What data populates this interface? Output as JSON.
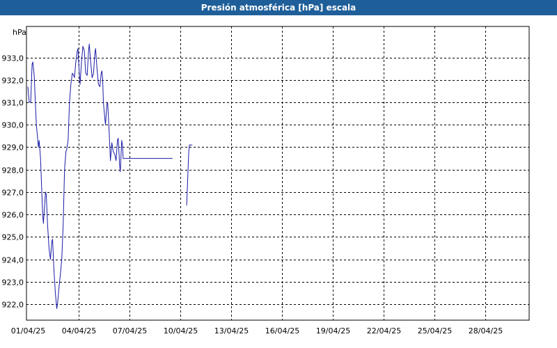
{
  "window": {
    "title": "Presión atmosférica [hPa] escala"
  },
  "colors": {
    "title_bar": "#1f5f99",
    "series": "#1a1aa6",
    "grid": "#000000"
  },
  "chart_data": {
    "type": "line",
    "title": "Presión atmosférica [hPa] escala",
    "ylabel": "hPa",
    "xlabel": "",
    "x_unit": "days",
    "xlim": [
      "01/04/25",
      "01/05/25"
    ],
    "ylim": [
      921.0,
      934.2
    ],
    "grid": true,
    "legend": "none",
    "yticks": [
      922.0,
      923.0,
      924.0,
      925.0,
      926.0,
      927.0,
      928.0,
      929.0,
      930.0,
      931.0,
      932.0,
      933.0
    ],
    "ytick_labels": [
      "922,0",
      "923,0",
      "924,0",
      "925,0",
      "926,0",
      "927,0",
      "928,0",
      "929,0",
      "930,0",
      "931,0",
      "932,0",
      "933,0"
    ],
    "xticks": [
      "01/04/25",
      "04/04/25",
      "07/04/25",
      "10/04/25",
      "13/04/25",
      "16/04/25",
      "19/04/25",
      "22/04/25",
      "25/04/25",
      "28/04/25"
    ],
    "series": [
      {
        "segments": [
          [
            [
              "01/04/25 00:00",
              931.7
            ],
            [
              "01/04/25 02:00",
              931.0
            ],
            [
              "01/04/25 04:00",
              931.0
            ],
            [
              "01/04/25 06:00",
              932.7
            ],
            [
              "01/04/25 07:00",
              932.8
            ],
            [
              "01/04/25 09:00",
              932.2
            ],
            [
              "01/04/25 12:00",
              930.0
            ],
            [
              "01/04/25 15:00",
              929.0
            ],
            [
              "01/04/25 16:00",
              929.3
            ],
            [
              "01/04/25 18:00",
              928.5
            ],
            [
              "01/04/25 21:00",
              926.0
            ],
            [
              "01/04/25 22:00",
              925.6
            ],
            [
              "02/04/25 00:00",
              926.5
            ],
            [
              "02/04/25 01:00",
              927.0
            ],
            [
              "02/04/25 02:00",
              926.9
            ],
            [
              "02/04/25 04:00",
              925.5
            ],
            [
              "02/04/25 06:00",
              924.5
            ],
            [
              "02/04/25 08:00",
              924.0
            ],
            [
              "02/04/25 10:00",
              924.8
            ],
            [
              "02/04/25 11:00",
              924.9
            ],
            [
              "02/04/25 13:00",
              923.5
            ],
            [
              "02/04/25 15:00",
              922.5
            ],
            [
              "02/04/25 17:00",
              921.8
            ],
            [
              "02/04/25 18:00",
              922.0
            ],
            [
              "02/04/25 20:00",
              922.7
            ],
            [
              "02/04/25 22:00",
              923.3
            ],
            [
              "03/04/25 00:00",
              924.0
            ],
            [
              "03/04/25 02:00",
              925.5
            ],
            [
              "03/04/25 04:00",
              928.0
            ],
            [
              "03/04/25 06:00",
              928.8
            ],
            [
              "03/04/25 07:00",
              928.9
            ],
            [
              "03/04/25 09:00",
              929.3
            ],
            [
              "03/04/25 11:00",
              931.0
            ],
            [
              "03/04/25 13:00",
              931.8
            ],
            [
              "03/04/25 15:00",
              932.3
            ],
            [
              "03/04/25 17:00",
              932.2
            ],
            [
              "03/04/25 18:00",
              932.1
            ],
            [
              "03/04/25 20:00",
              932.8
            ],
            [
              "03/04/25 22:00",
              933.3
            ],
            [
              "03/04/25 23:00",
              933.4
            ],
            [
              "04/04/25 01:00",
              932.2
            ],
            [
              "04/04/25 02:00",
              931.8
            ],
            [
              "04/04/25 04:00",
              932.8
            ],
            [
              "04/04/25 06:00",
              933.5
            ],
            [
              "04/04/25 08:00",
              933.3
            ],
            [
              "04/04/25 10:00",
              932.3
            ],
            [
              "04/04/25 12:00",
              932.2
            ],
            [
              "04/04/25 14:00",
              933.3
            ],
            [
              "04/04/25 15:00",
              933.6
            ],
            [
              "04/04/25 17:00",
              932.8
            ],
            [
              "04/04/25 19:00",
              932.1
            ],
            [
              "04/04/25 21:00",
              932.3
            ],
            [
              "04/04/25 23:00",
              933.2
            ],
            [
              "05/04/25 00:00",
              933.4
            ],
            [
              "05/04/25 02:00",
              932.5
            ],
            [
              "05/04/25 04:00",
              931.8
            ],
            [
              "05/04/25 06:00",
              931.7
            ],
            [
              "05/04/25 08:00",
              932.3
            ],
            [
              "05/04/25 09:00",
              932.4
            ],
            [
              "05/04/25 10:00",
              932.0
            ],
            [
              "05/04/25 11:00",
              931.0
            ],
            [
              "05/04/25 13:00",
              930.3
            ],
            [
              "05/04/25 14:00",
              930.0
            ],
            [
              "05/04/25 16:00",
              930.9
            ],
            [
              "05/04/25 17:00",
              931.0
            ],
            [
              "05/04/25 19:00",
              929.8
            ],
            [
              "05/04/25 21:00",
              928.4
            ],
            [
              "05/04/25 23:00",
              929.2
            ],
            [
              "06/04/25 01:00",
              928.8
            ],
            [
              "06/04/25 03:00",
              928.7
            ],
            [
              "06/04/25 05:00",
              928.4
            ],
            [
              "06/04/25 07:00",
              929.3
            ],
            [
              "06/04/25 08:00",
              929.4
            ],
            [
              "06/04/25 10:00",
              928.2
            ],
            [
              "06/04/25 11:00",
              927.9
            ],
            [
              "06/04/25 13:00",
              929.3
            ],
            [
              "06/04/25 14:00",
              929.1
            ],
            [
              "06/04/25 15:00",
              928.5
            ],
            [
              "09/04/25 13:00",
              928.5
            ]
          ],
          [
            [
              "10/04/25 09:00",
              926.4
            ],
            [
              "10/04/25 12:00",
              928.8
            ],
            [
              "10/04/25 13:00",
              929.1
            ],
            [
              "10/04/25 17:00",
              929.1
            ]
          ]
        ]
      }
    ]
  }
}
